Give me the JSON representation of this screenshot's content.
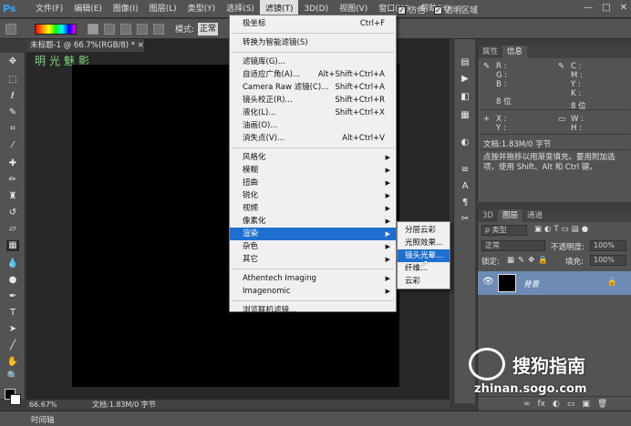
{
  "app": {
    "logo": "Ps"
  },
  "menubar": {
    "items": [
      "文件(F)",
      "编辑(E)",
      "图像(I)",
      "图层(L)",
      "类型(Y)",
      "选择(S)",
      "滤镜(T)",
      "3D(D)",
      "视图(V)",
      "窗口(W)",
      "帮助(H)"
    ],
    "active_index": 6,
    "window_controls": [
      "—",
      "□",
      "✕"
    ]
  },
  "options_bar": {
    "mode_label": "模式:",
    "mode_value": "正常",
    "reverse_label": "反向",
    "dither_label": "仿色",
    "transparency_label": "透明区域"
  },
  "document": {
    "tab_title": "未标题-1 @ 66.7%(RGB/8) *",
    "tab_close": "×",
    "zoom": "66.67%",
    "status": "文档:1.83M/0 字节",
    "overlay_text": "明光魅影"
  },
  "timeline_label": "时间轴",
  "filter_menu": {
    "items": [
      {
        "label": "极坐标",
        "shortcut": "Ctrl+F"
      },
      {
        "sep": true
      },
      {
        "label": "转换为智能滤镜(S)"
      },
      {
        "sep": true
      },
      {
        "label": "滤镜库(G)..."
      },
      {
        "label": "自适应广角(A)...",
        "shortcut": "Alt+Shift+Ctrl+A"
      },
      {
        "label": "Camera Raw 滤镜(C)...",
        "shortcut": "Shift+Ctrl+A"
      },
      {
        "label": "镜头校正(R)...",
        "shortcut": "Shift+Ctrl+R"
      },
      {
        "label": "液化(L)...",
        "shortcut": "Shift+Ctrl+X"
      },
      {
        "label": "油画(O)..."
      },
      {
        "label": "消失点(V)...",
        "shortcut": "Alt+Ctrl+V"
      },
      {
        "sep": true
      },
      {
        "label": "风格化",
        "sub": true
      },
      {
        "label": "模糊",
        "sub": true
      },
      {
        "label": "扭曲",
        "sub": true
      },
      {
        "label": "锐化",
        "sub": true
      },
      {
        "label": "视频",
        "sub": true
      },
      {
        "label": "像素化",
        "sub": true
      },
      {
        "label": "渲染",
        "sub": true,
        "highlight": true
      },
      {
        "label": "杂色",
        "sub": true
      },
      {
        "label": "其它",
        "sub": true
      },
      {
        "sep": true
      },
      {
        "label": "Athentech Imaging",
        "sub": true
      },
      {
        "label": "Imagenomic",
        "sub": true
      },
      {
        "sep": true
      },
      {
        "label": "浏览联机滤镜..."
      }
    ]
  },
  "render_submenu": {
    "items": [
      {
        "label": "分层云彩"
      },
      {
        "label": "光照效果..."
      },
      {
        "label": "镜头光晕...",
        "highlight": true
      },
      {
        "label": "纤维..."
      },
      {
        "label": "云彩"
      }
    ]
  },
  "info_panel": {
    "tabs": [
      "属性",
      "信息"
    ],
    "active_tab": 1,
    "rgb_labels": [
      "R :",
      "G :",
      "B :"
    ],
    "cmyk_labels": [
      "C :",
      "M :",
      "Y :",
      "K :"
    ],
    "bit_left": "8 位",
    "bit_right": "8 位",
    "xy_labels": [
      "X :",
      "Y :"
    ],
    "wh_labels": [
      "W :",
      "H :"
    ],
    "doc_info": "文档:1.83M/0 字节",
    "hint": "点按并拖移以用渐变填充。要用附加选项，使用 Shift、Alt 和 Ctrl 键。"
  },
  "layers_panel": {
    "tabs": [
      "3D",
      "图层",
      "通道"
    ],
    "active_tab": 1,
    "kind_filter": "ρ 类型",
    "blend_mode": "正常",
    "opacity_label": "不透明度:",
    "opacity_value": "100%",
    "lock_label": "锁定:",
    "fill_label": "填充:",
    "fill_value": "100%",
    "layer_name": "背景",
    "bottom_icons": [
      "∞",
      "fx",
      "◐",
      "▭",
      "▣",
      "🗑"
    ]
  },
  "watermark": {
    "brand": "搜狗指南",
    "url": "zhinan.sogo.com"
  },
  "colors": {
    "menu_bg": "#535353",
    "highlight_blue": "#1f6fcf",
    "layer_selected": "#6d8bb4",
    "annotation_yellow": "#c8e600"
  }
}
